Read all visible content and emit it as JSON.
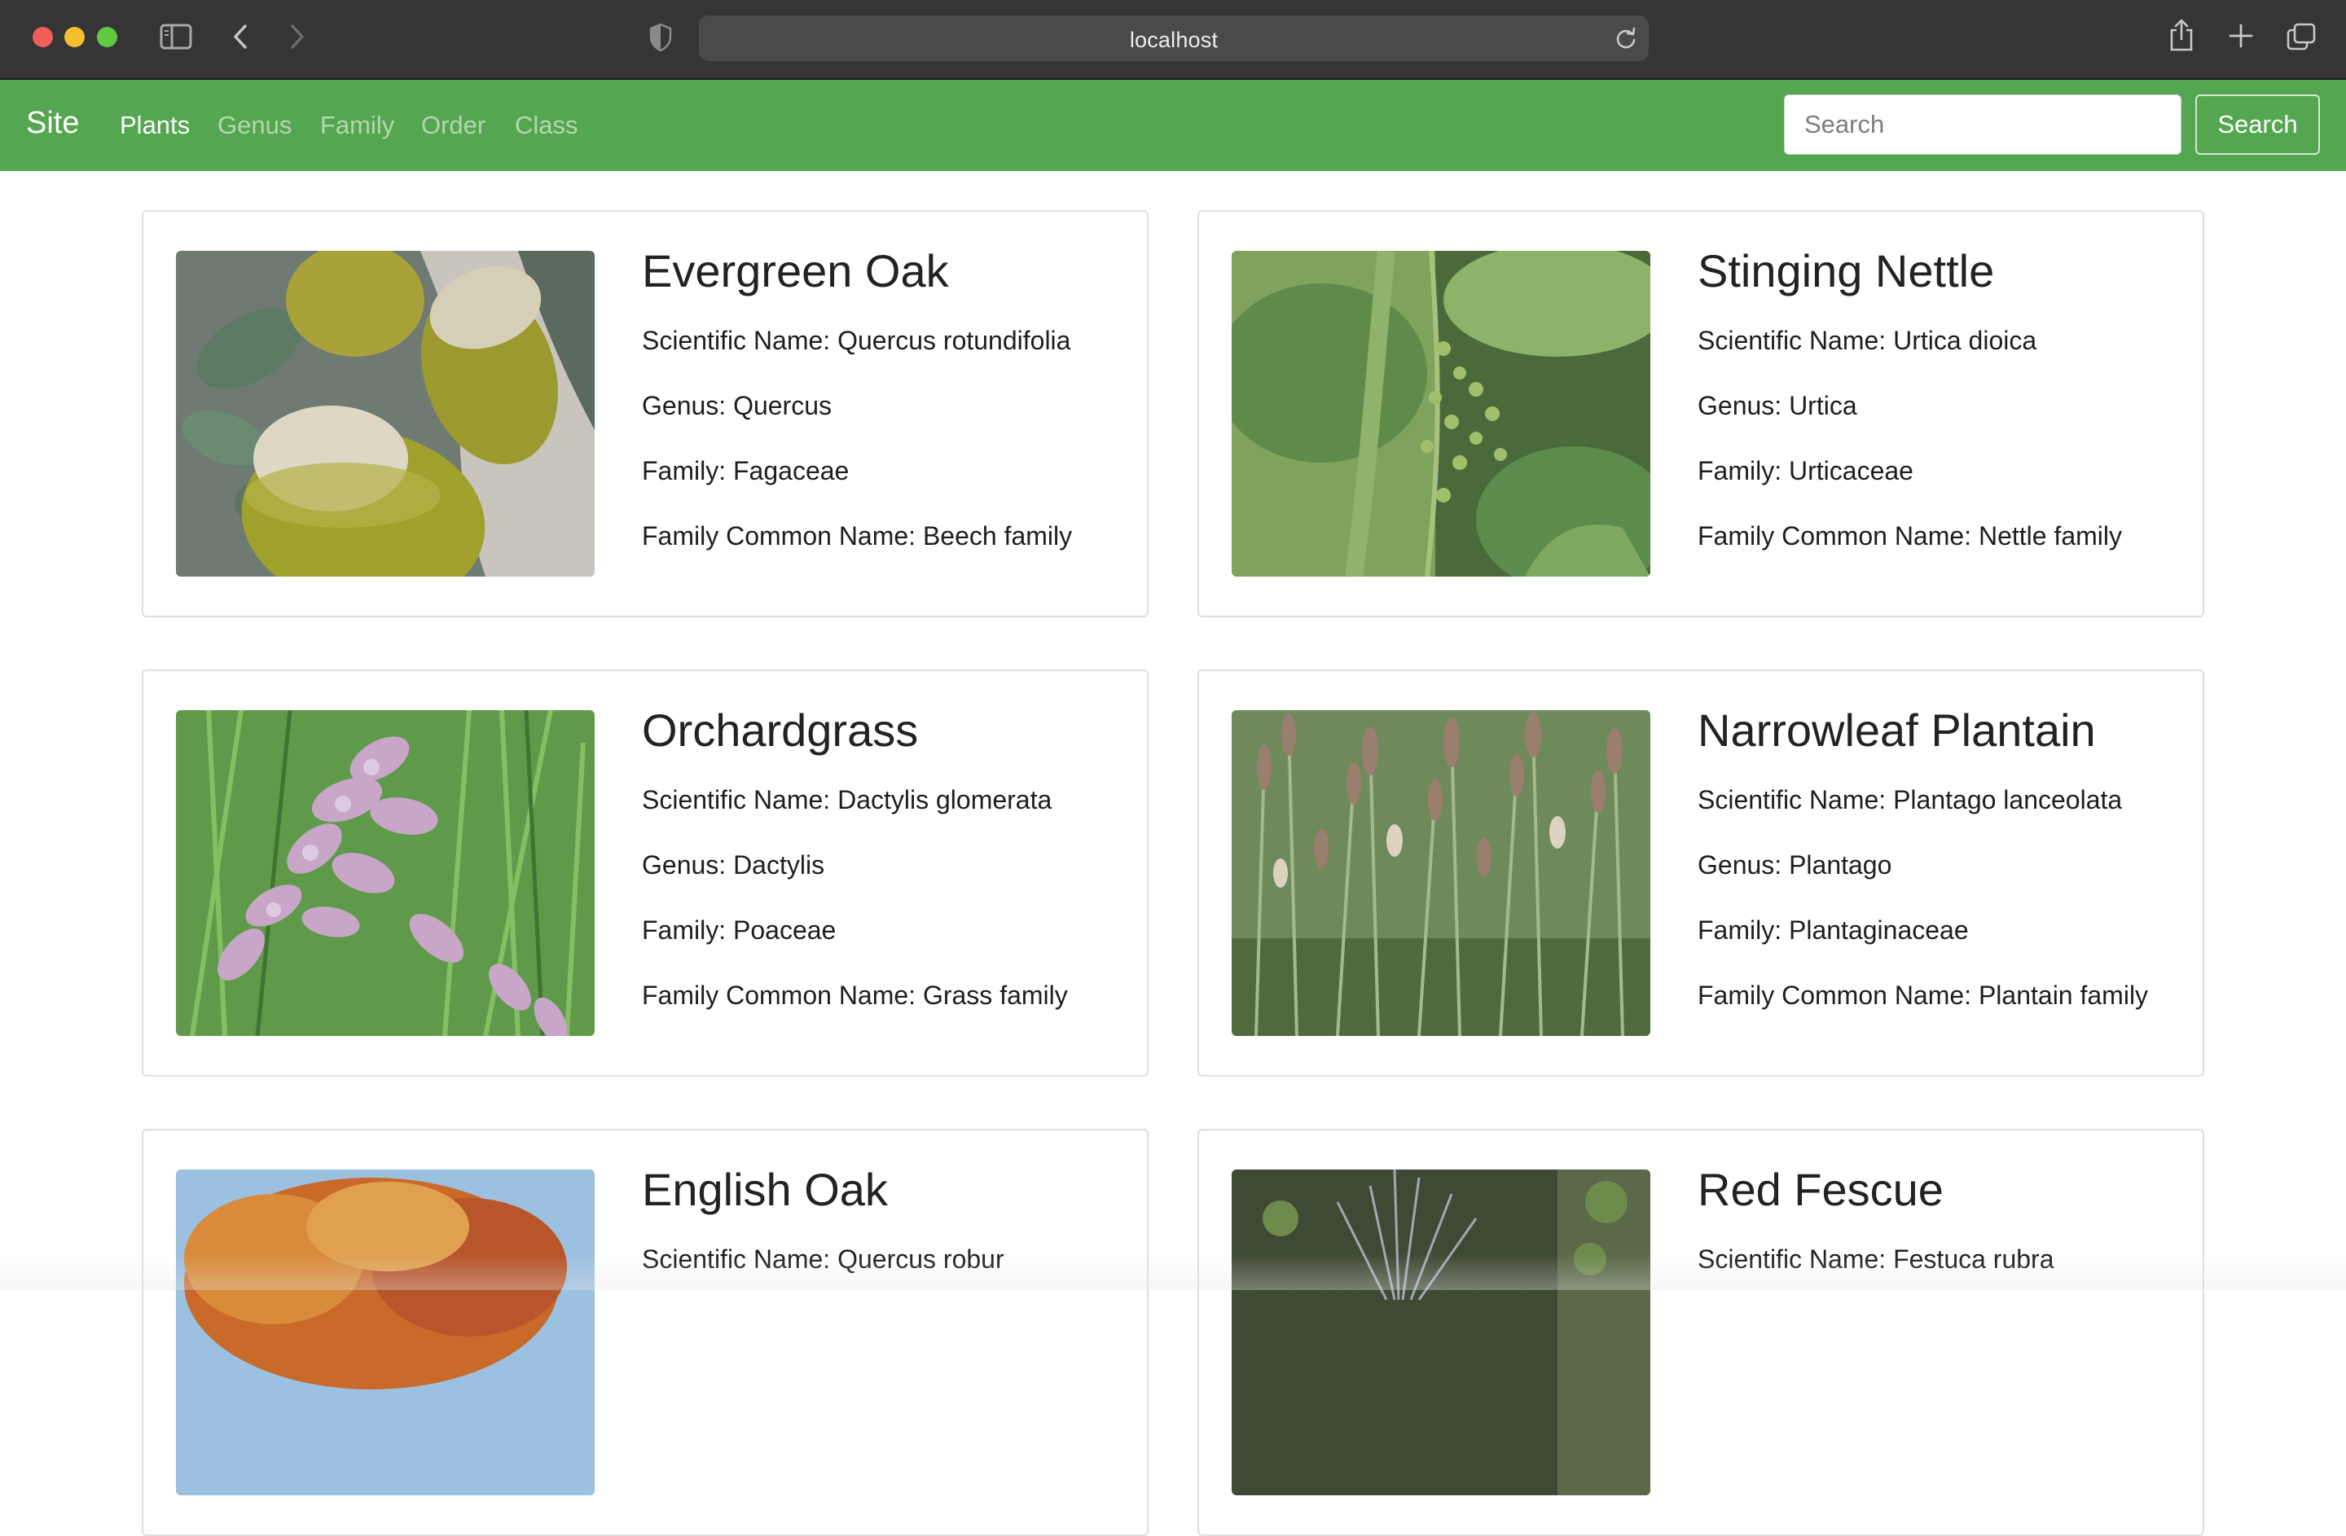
{
  "browser": {
    "url": "localhost",
    "icons": [
      "sidebar-icon",
      "back-icon",
      "forward-icon",
      "privacy-shield-icon",
      "reload-icon",
      "share-icon",
      "new-tab-icon",
      "tab-overview-icon"
    ]
  },
  "navbar": {
    "brand": "Site",
    "links": [
      {
        "label": "Plants",
        "active": true
      },
      {
        "label": "Genus",
        "active": false
      },
      {
        "label": "Family",
        "active": false
      },
      {
        "label": "Order",
        "active": false
      },
      {
        "label": "Class",
        "active": false
      }
    ],
    "search": {
      "placeholder": "Search",
      "value": "",
      "button_label": "Search"
    },
    "color": "#55a651"
  },
  "plants": [
    {
      "name": "Evergreen Oak",
      "scientific": "Scientific Name: Quercus rotundifolia",
      "genus": "Genus: Quercus",
      "family": "Family: Fagaceae",
      "family_common": "Family Common Name: Beech family"
    },
    {
      "name": "Stinging Nettle",
      "scientific": "Scientific Name: Urtica dioica",
      "genus": "Genus: Urtica",
      "family": "Family: Urticaceae",
      "family_common": "Family Common Name: Nettle family"
    },
    {
      "name": "Orchardgrass",
      "scientific": "Scientific Name: Dactylis glomerata",
      "genus": "Genus: Dactylis",
      "family": "Family: Poaceae",
      "family_common": "Family Common Name: Grass family"
    },
    {
      "name": "Narrowleaf Plantain",
      "scientific": "Scientific Name: Plantago lanceolata",
      "genus": "Genus: Plantago",
      "family": "Family: Plantaginaceae",
      "family_common": "Family Common Name: Plantain family"
    },
    {
      "name": "English Oak",
      "scientific": "Scientific Name: Quercus robur"
    },
    {
      "name": "Red Fescue",
      "scientific": "Scientific Name: Festuca rubra"
    }
  ]
}
